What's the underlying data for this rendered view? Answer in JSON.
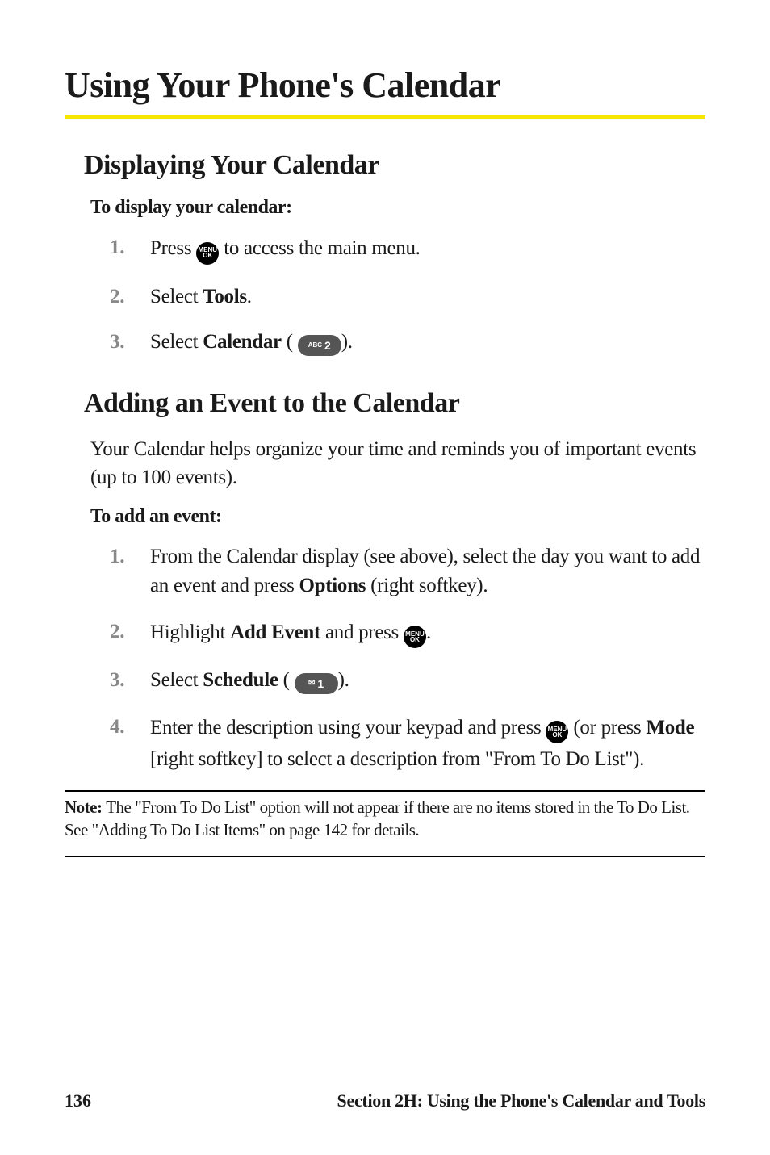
{
  "title": "Using Your Phone's Calendar",
  "sections": {
    "display": {
      "heading": "Displaying Your Calendar",
      "lead": "To display your calendar:",
      "steps": {
        "s1": {
          "num": "1.",
          "pre": "Press ",
          "post": " to access the main menu."
        },
        "s2": {
          "num": "2.",
          "pre": "Select ",
          "bold": "Tools",
          "post": "."
        },
        "s3": {
          "num": "3.",
          "pre": "Select ",
          "bold": "Calendar",
          "paren_open": " (",
          "paren_close": ")."
        }
      }
    },
    "add": {
      "heading": "Adding an Event to the Calendar",
      "intro": "Your Calendar helps organize your time and reminds you of important events (up to 100 events).",
      "lead": "To add an event:",
      "steps": {
        "s1": {
          "num": "1.",
          "pre": "From the Calendar display (see above), select the day you want to add an event and press ",
          "bold": "Options",
          "post": " (right softkey)."
        },
        "s2": {
          "num": "2.",
          "pre": "Highlight ",
          "bold": "Add Event",
          "mid": " and press ",
          "post": "."
        },
        "s3": {
          "num": "3.",
          "pre": "Select ",
          "bold": "Schedule",
          "paren_open": " (",
          "paren_close": ")."
        },
        "s4": {
          "num": "4.",
          "pre": "Enter the description using your keypad and press ",
          "mid": " (or press ",
          "bold": "Mode",
          "post": " [right softkey] to select a description from \"From To Do List\")."
        }
      }
    }
  },
  "note": {
    "label": "Note: ",
    "text": "The \"From To Do List\" option will not appear if there are no items stored in the To Do List. See \"Adding To Do List Items\" on page 142 for details."
  },
  "icons": {
    "menu_ok": {
      "l1": "MENU",
      "l2": "OK"
    },
    "abc2": {
      "sub": "ABC",
      "big": "2"
    },
    "env1": {
      "env": "✉",
      "big": "1"
    }
  },
  "footer": {
    "page": "136",
    "section": "Section 2H: Using the Phone's Calendar and Tools"
  }
}
